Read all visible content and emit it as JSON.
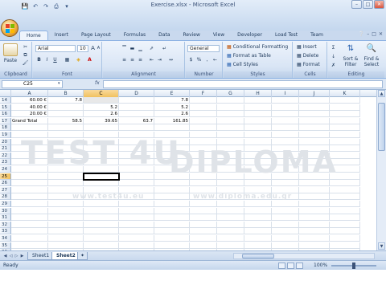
{
  "window": {
    "title": "Exercise.xlsx - Microsoft Excel"
  },
  "quick_access": [
    "save-icon",
    "undo-icon",
    "redo-icon",
    "print-preview-icon"
  ],
  "tabs": [
    "Home",
    "Insert",
    "Page Layout",
    "Formulas",
    "Data",
    "Review",
    "View",
    "Developer",
    "Load Test",
    "Team"
  ],
  "active_tab": "Home",
  "ribbon": {
    "clipboard": {
      "label": "Clipboard",
      "paste": "Paste"
    },
    "font": {
      "label": "Font",
      "name": "Arial",
      "size": "10",
      "bold": "B",
      "italic": "I",
      "underline": "U"
    },
    "alignment": {
      "label": "Alignment"
    },
    "number": {
      "label": "Number",
      "format": "General",
      "currency": "$",
      "percent": "%",
      "comma": ","
    },
    "styles": {
      "label": "Styles",
      "conditional": "Conditional Formatting",
      "format_table": "Format as Table",
      "cell_styles": "Cell Styles"
    },
    "cells": {
      "label": "Cells",
      "insert": "Insert",
      "delete": "Delete",
      "format": "Format"
    },
    "editing": {
      "label": "Editing",
      "sort": "Sort &",
      "sort2": "Filter",
      "find": "Find &",
      "find2": "Select"
    }
  },
  "formula_bar": {
    "name_box": "C25",
    "fx": "fx",
    "content": ""
  },
  "columns": [
    "A",
    "B",
    "C",
    "D",
    "E",
    "F",
    "G",
    "H",
    "I",
    "J",
    "K"
  ],
  "rows": [
    {
      "n": "14",
      "A": "60.00 €",
      "B": "7.8",
      "C": "",
      "D": "",
      "E": "7.8"
    },
    {
      "n": "15",
      "A": "40.00 €",
      "B": "",
      "C": "5.2",
      "D": "",
      "E": "5.2"
    },
    {
      "n": "16",
      "A": "20.00 €",
      "B": "",
      "C": "2.6",
      "D": "",
      "E": "2.6"
    },
    {
      "n": "17",
      "A": "Grand Total",
      "B": "58.5",
      "C": "39.65",
      "D": "63.7",
      "E": "161.85"
    },
    {
      "n": "18"
    },
    {
      "n": "19"
    },
    {
      "n": "20"
    },
    {
      "n": "21"
    },
    {
      "n": "22"
    },
    {
      "n": "23"
    },
    {
      "n": "24"
    },
    {
      "n": "25"
    },
    {
      "n": "26"
    },
    {
      "n": "27"
    },
    {
      "n": "28"
    },
    {
      "n": "29"
    },
    {
      "n": "30"
    },
    {
      "n": "31"
    },
    {
      "n": "32"
    },
    {
      "n": "33"
    },
    {
      "n": "34"
    },
    {
      "n": "35"
    },
    {
      "n": "36"
    }
  ],
  "sheets": [
    "Sheet1",
    "Sheet2"
  ],
  "active_sheet": "Sheet2",
  "status": {
    "text": "Ready",
    "zoom": "100%"
  },
  "watermark": {
    "left": "TEST 4U",
    "right": "DIPLOMA",
    "url_left": "www.test4u.eu",
    "url_right": "www.diploma.edu.gr"
  },
  "colors": {
    "accent": "#1e395b",
    "selection": "#f1c15f",
    "ribbon": "#dbe6f4"
  }
}
